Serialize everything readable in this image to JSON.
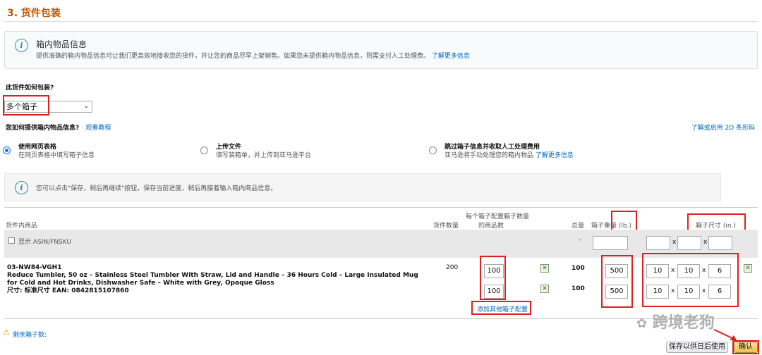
{
  "section_title": "3. 货件包装",
  "info_box": {
    "title": "箱内物品信息",
    "text": "提供准确的箱内物品信息可让我们更高效地接收您的货件，并让您的商品尽早上架销售。如果您未提供箱内物品信息，则需支付人工处理费。",
    "link": "了解更多信息"
  },
  "packing_question": "此货件如何包装?",
  "packing_select": "多个箱子",
  "box_info_question": "您如何提供箱内物品信息?",
  "watch_tutorial": "观看教程",
  "learn_2d": "了解或启用 2D 条形码",
  "options": [
    {
      "title": "使用网页表格",
      "desc": "在网页表格中填写箱子信息",
      "selected": true
    },
    {
      "title": "上传文件",
      "desc": "填写装箱单，并上传到亚马逊平台",
      "selected": false
    },
    {
      "title": "跳过箱子信息并收取人工处理费用",
      "desc": "亚马逊将手动处理您的箱内物品",
      "link": "了解更多信息",
      "selected": false
    }
  ],
  "note": "您可以点击\"保存，稍后再继续\"按钮，保存当前进度，稍后再接着输入箱内商品信息。",
  "table": {
    "col_product": "货件内商品",
    "col_qty": "货件数量",
    "col_per_box_1": "每个箱子配置箱子数量",
    "col_per_box_2": "的商品数",
    "col_total": "总量",
    "col_weight": "箱子重量 (lb.)",
    "col_dims": "箱子尺寸 (in.)",
    "show_asin": "显示 ASIN/FNSKU",
    "summary_dash": "-",
    "dim_sep": "x"
  },
  "product": {
    "sku": "03-NW84-VGH1",
    "name": "Reduce Tumbler, 50 oz – Stainless Steel Tumbler With Straw, Lid and Handle – 36 Hours Cold – Large Insulated Mug for Cold and Hot Drinks, Dishwasher Safe – White with Grey, Opaque Gloss",
    "size": "尺寸: 标准尺寸 EAN: 0842815107860",
    "qty": "200"
  },
  "box_configs": [
    {
      "per_box": "100",
      "total": "100",
      "weight": "500",
      "l": "10",
      "w": "10",
      "h": "6"
    },
    {
      "per_box": "100",
      "total": "100",
      "weight": "500",
      "l": "10",
      "w": "10",
      "h": "6"
    }
  ],
  "add_config": "添加其他箱子配置",
  "remaining_boxes": "剩余箱子数:",
  "watermark": "跨境老狗",
  "buttons": {
    "save": "保存以供日后使用",
    "confirm": "确认"
  }
}
